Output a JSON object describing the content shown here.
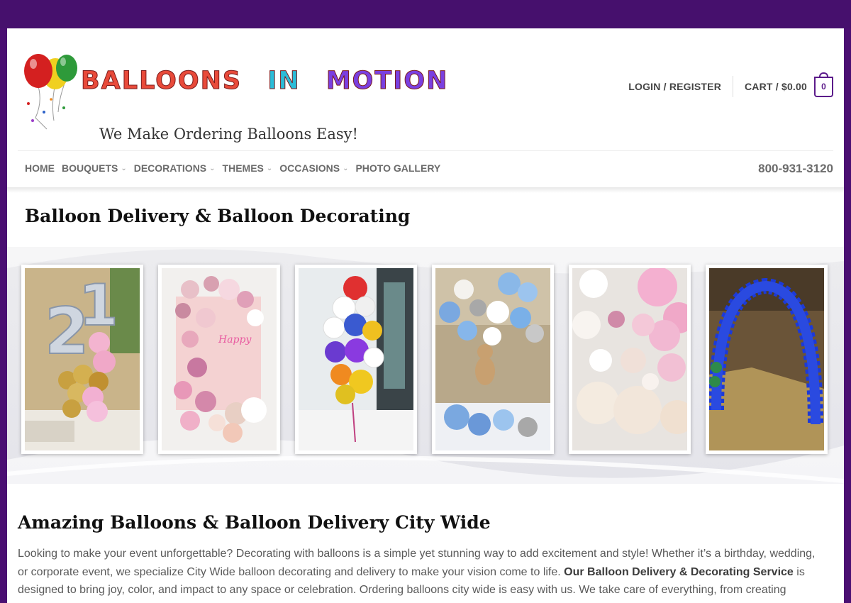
{
  "brand": {
    "logo_text": "BALLOONS IN MOTION",
    "logo_words": [
      "BALLOONS",
      "IN",
      "MOTION"
    ],
    "tagline": "We Make Ordering Balloons Easy!",
    "colors": {
      "purple": "#5b1a8a",
      "background": "#4a0f72"
    }
  },
  "header": {
    "login_label": "LOGIN / REGISTER",
    "cart_label": "CART / $0.00",
    "cart_count": "0",
    "cart_icon": "shopping-bag-icon"
  },
  "nav": {
    "items": [
      {
        "label": "HOME",
        "dropdown": false
      },
      {
        "label": "BOUQUETS",
        "dropdown": true
      },
      {
        "label": "DECORATIONS",
        "dropdown": true
      },
      {
        "label": "THEMES",
        "dropdown": true
      },
      {
        "label": "OCCASIONS",
        "dropdown": true
      },
      {
        "label": "PHOTO GALLERY",
        "dropdown": false
      }
    ],
    "dropdown_icon": "chevron-down-icon",
    "phone": "800-931-3120"
  },
  "page_title": "Balloon Delivery & Balloon Decorating",
  "gallery": {
    "photos": [
      "Silver number 21 balloon bouquet with gold and pink balloons",
      "Pink balloon garland wall with flowers",
      "Colorful birthday balloon bouquet",
      "Blue and white balloon centerpiece with teddy bear",
      "White and pink balloon garland with flowers",
      "Blue balloon arch in a venue"
    ]
  },
  "content": {
    "heading": "Amazing Balloons & Balloon Delivery City Wide",
    "para_1": "Looking to make your event unforgettable? Decorating with balloons is a simple yet stunning way to add excitement and style! Whether it’s a birthday, wedding, or corporate event, we specialize City Wide balloon decorating and delivery to make your vision come to life. ",
    "para_bold": "Our Balloon Delivery & Decorating Service",
    "para_2": " is designed to bring joy, color, and impact to any space or celebration. Ordering balloons city wide is easy with us. We take care of everything, from creating beautiful designs to"
  }
}
